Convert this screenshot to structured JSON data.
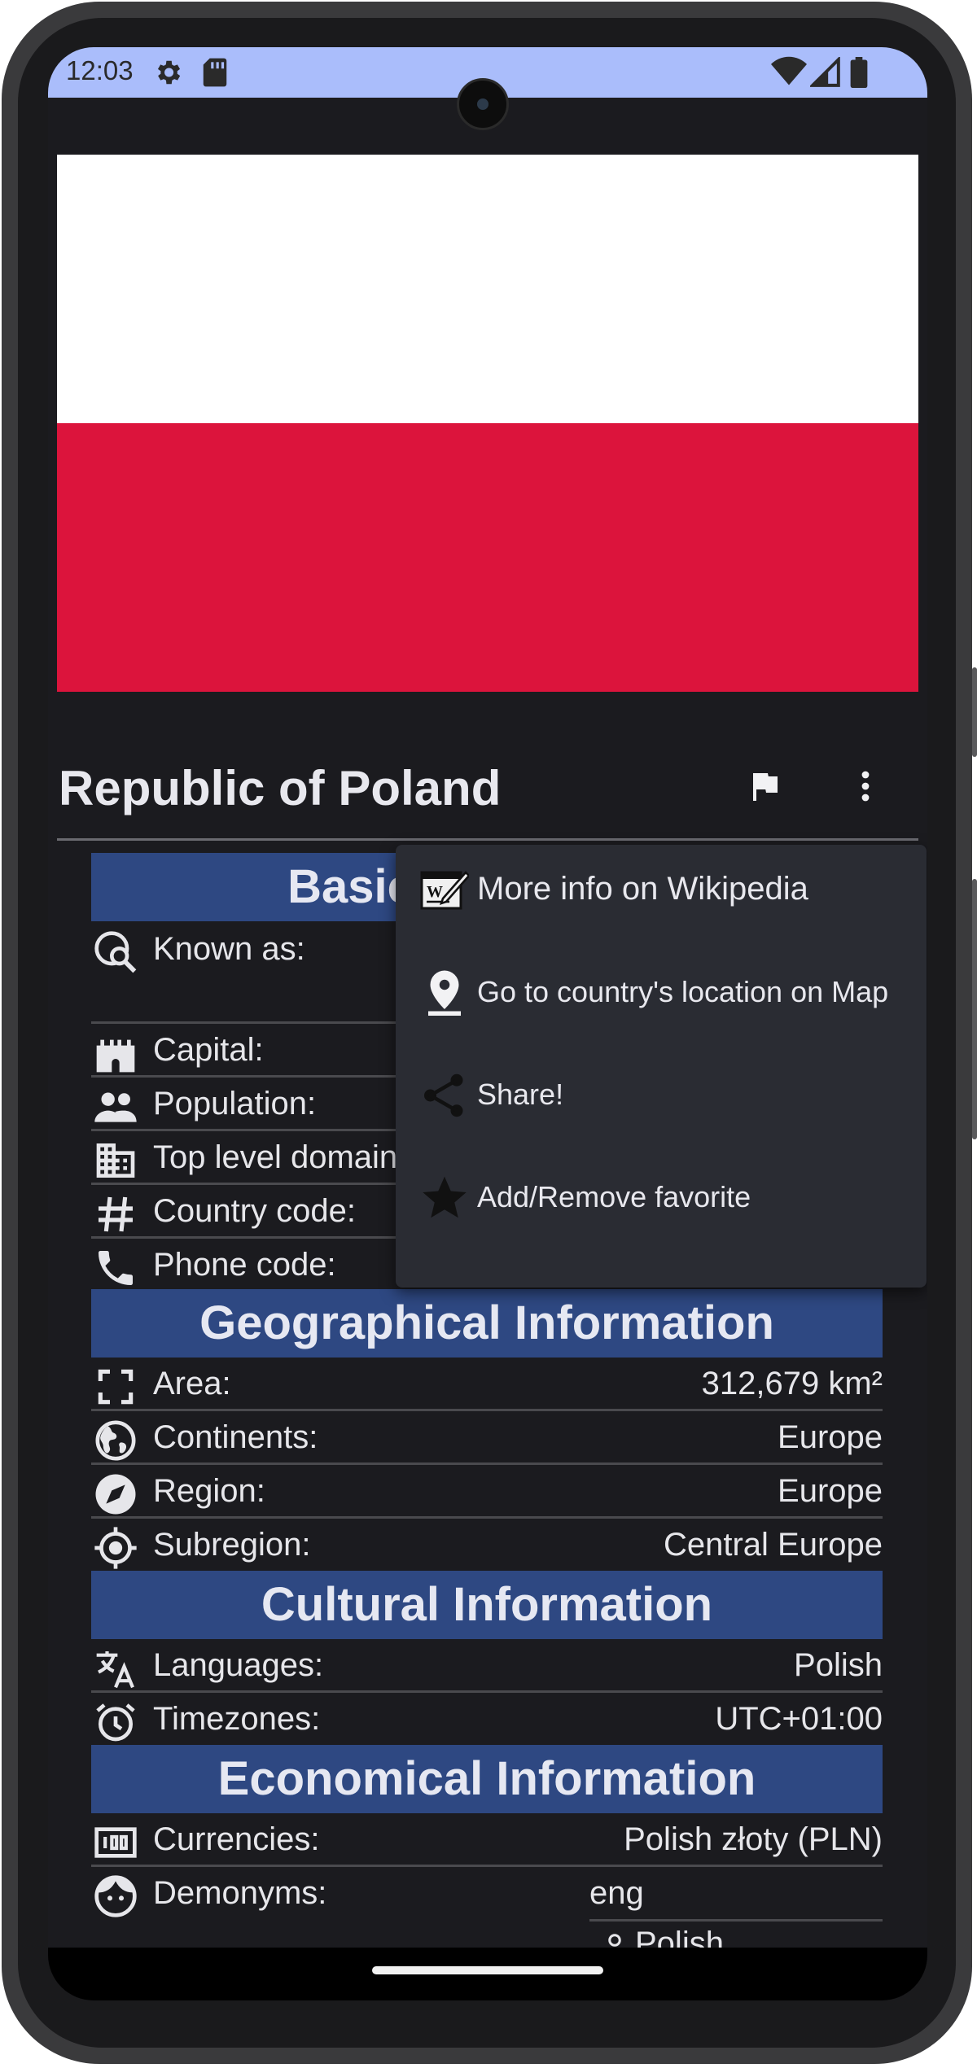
{
  "status_bar": {
    "time": "12:03"
  },
  "country": {
    "name": "Republic of Poland",
    "flag_colors": [
      "#ffffff",
      "#dc143c"
    ]
  },
  "toolbar": {
    "flag_icon": "flag-icon",
    "more_icon": "more-vert-icon"
  },
  "sections": {
    "basic": "Basic Information",
    "geo": "Geographical Information",
    "cultural": "Cultural Information",
    "economical": "Economical Information"
  },
  "basic_rows": {
    "known_as": "Known as:",
    "capital": "Capital:",
    "population": "Population:",
    "tld": "Top level domain:",
    "country_code": "Country code:",
    "phone_code": "Phone code:"
  },
  "geo_rows": {
    "area": {
      "label": "Area:",
      "value": "312,679 km²"
    },
    "continents": {
      "label": "Continents:",
      "value": "Europe"
    },
    "region": {
      "label": "Region:",
      "value": "Europe"
    },
    "subregion": {
      "label": "Subregion:",
      "value": "Central Europe"
    }
  },
  "cultural_rows": {
    "languages": {
      "label": "Languages:",
      "value": "Polish"
    },
    "timezones": {
      "label": "Timezones:",
      "value": "UTC+01:00"
    }
  },
  "economical_rows": {
    "currencies": {
      "label": "Currencies:",
      "value": "Polish złoty (PLN)"
    },
    "demonyms": {
      "label": "Demonyms:",
      "value": "eng",
      "value2": "Polish"
    }
  },
  "menu": {
    "items": [
      {
        "label": "More info on Wikipedia",
        "icon": "wikipedia-icon"
      },
      {
        "label": "Go to country's location on Map",
        "icon": "location-pin-icon"
      },
      {
        "label": "Share!",
        "icon": "share-icon"
      },
      {
        "label": "Add/Remove favorite",
        "icon": "star-icon"
      }
    ]
  },
  "colors": {
    "status_bar": "#aabdfb",
    "section_header": "#2e4882",
    "background": "#1b1b1f",
    "menu": "#2a2c33"
  }
}
